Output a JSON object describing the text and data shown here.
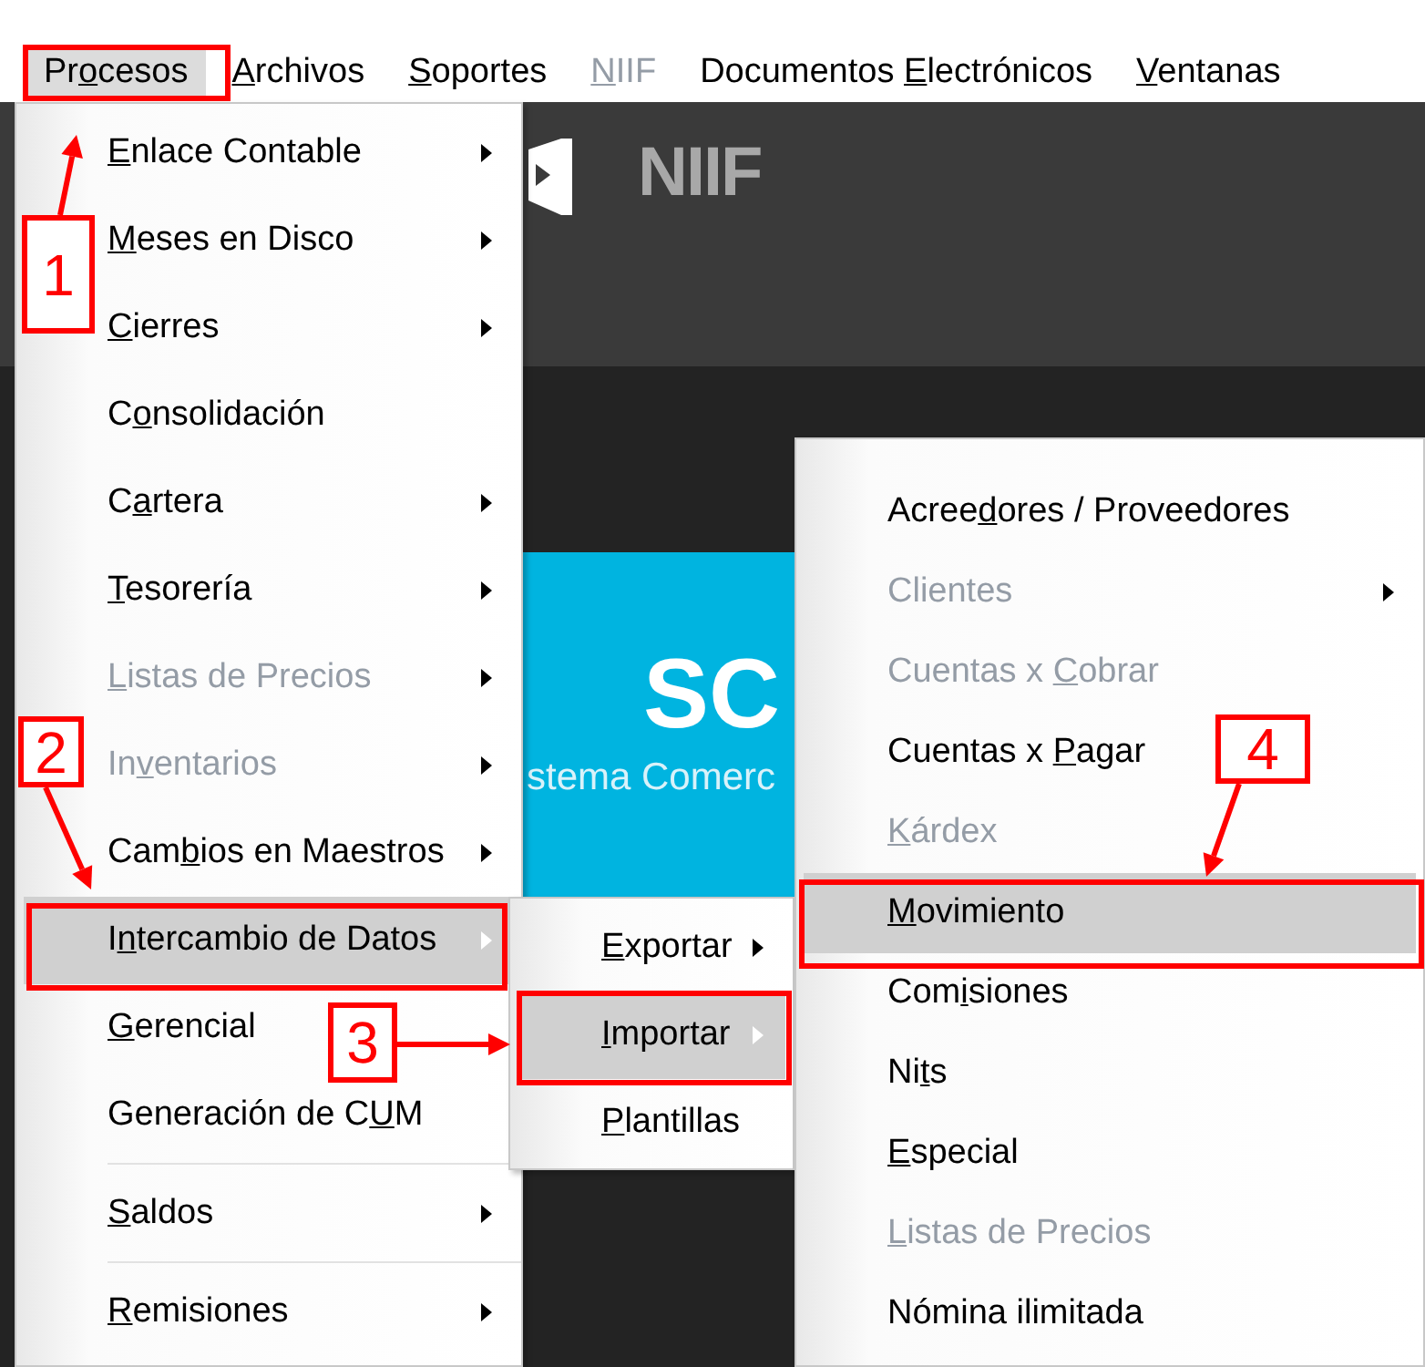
{
  "menu_bar": {
    "items": [
      {
        "before": "Pr",
        "mnemonic": "o",
        "after": "cesos",
        "selected": true,
        "disabled": false
      },
      {
        "mnemonic": "A",
        "after": "rchivos",
        "selected": false,
        "disabled": false
      },
      {
        "mnemonic": "S",
        "after": "oportes",
        "selected": false,
        "disabled": false
      },
      {
        "mnemonic": "N",
        "after": "IIF",
        "selected": false,
        "disabled": true
      },
      {
        "before": "Documentos ",
        "mnemonic": "E",
        "after": "lectrónicos",
        "selected": false,
        "disabled": false
      },
      {
        "mnemonic": "V",
        "after": "entanas",
        "selected": false,
        "disabled": false
      }
    ]
  },
  "desktop": {
    "logo_text": "NIIF",
    "banner_title": "SC",
    "banner_subtitle": "stema Comerc"
  },
  "menus": [
    {
      "items": [
        {
          "kind": "item",
          "mnemonic": "E",
          "after": "nlace Contable",
          "submenu": true,
          "disabled": false,
          "selected": false
        },
        {
          "kind": "item",
          "mnemonic": "M",
          "after": "eses en Disco",
          "submenu": true,
          "disabled": false,
          "selected": false
        },
        {
          "kind": "item",
          "mnemonic": "C",
          "after": "ierres",
          "submenu": true,
          "disabled": false,
          "selected": false
        },
        {
          "kind": "item",
          "before": "C",
          "mnemonic": "o",
          "after": "nsolidación",
          "submenu": false,
          "disabled": false,
          "selected": false
        },
        {
          "kind": "item",
          "before": "C",
          "mnemonic": "a",
          "after": "rtera",
          "submenu": true,
          "disabled": false,
          "selected": false
        },
        {
          "kind": "item",
          "mnemonic": "T",
          "after": "esorería",
          "submenu": true,
          "disabled": false,
          "selected": false
        },
        {
          "kind": "item",
          "mnemonic": "L",
          "after": "istas de Precios",
          "submenu": true,
          "disabled": true,
          "selected": false
        },
        {
          "kind": "item",
          "before": "In",
          "mnemonic": "v",
          "after": "entarios",
          "submenu": true,
          "disabled": true,
          "selected": false
        },
        {
          "kind": "item",
          "before": "Cam",
          "mnemonic": "b",
          "after": "ios en Maestros",
          "submenu": true,
          "disabled": false,
          "selected": false
        },
        {
          "kind": "item",
          "before": "I",
          "mnemonic": "n",
          "after": "tercambio de Datos",
          "submenu": true,
          "disabled": false,
          "selected": true
        },
        {
          "kind": "item",
          "mnemonic": "G",
          "after": "erencial",
          "submenu": false,
          "disabled": false,
          "selected": false
        },
        {
          "kind": "item",
          "before": "Generación de C",
          "mnemonic": "U",
          "after": "M",
          "submenu": false,
          "disabled": false,
          "selected": false
        },
        {
          "kind": "separator"
        },
        {
          "kind": "item",
          "mnemonic": "S",
          "after": "aldos",
          "submenu": true,
          "disabled": false,
          "selected": false
        },
        {
          "kind": "separator"
        },
        {
          "kind": "item",
          "mnemonic": "R",
          "after": "emisiones",
          "submenu": true,
          "disabled": false,
          "selected": false
        }
      ]
    },
    {
      "items": [
        {
          "kind": "item",
          "mnemonic": "E",
          "after": "xportar",
          "submenu": true,
          "disabled": false,
          "selected": false
        },
        {
          "kind": "item",
          "mnemonic": "I",
          "after": "mportar",
          "submenu": true,
          "disabled": false,
          "selected": true
        },
        {
          "kind": "item",
          "mnemonic": "P",
          "after": "lantillas",
          "submenu": false,
          "disabled": false,
          "selected": false
        }
      ]
    },
    {
      "items": [
        {
          "kind": "item",
          "before": "Acree",
          "mnemonic": "d",
          "after": "ores / Proveedores",
          "submenu": false,
          "disabled": false,
          "selected": false
        },
        {
          "kind": "item",
          "before": "Clientes",
          "submenu": true,
          "disabled": true,
          "selected": false
        },
        {
          "kind": "item",
          "before": "Cuentas x ",
          "mnemonic": "C",
          "after": "obrar",
          "submenu": false,
          "disabled": true,
          "selected": false
        },
        {
          "kind": "item",
          "before": "Cuentas x ",
          "mnemonic": "P",
          "after": "agar",
          "submenu": false,
          "disabled": false,
          "selected": false
        },
        {
          "kind": "item",
          "mnemonic": "K",
          "after": "árdex",
          "submenu": false,
          "disabled": true,
          "selected": false
        },
        {
          "kind": "item",
          "mnemonic": "M",
          "after": "ovimiento",
          "submenu": false,
          "disabled": false,
          "selected": true
        },
        {
          "kind": "item",
          "before": "Com",
          "mnemonic": "i",
          "after": "siones",
          "submenu": false,
          "disabled": false,
          "selected": false
        },
        {
          "kind": "item",
          "before": "Ni",
          "mnemonic": "t",
          "after": "s",
          "submenu": false,
          "disabled": false,
          "selected": false
        },
        {
          "kind": "item",
          "mnemonic": "E",
          "after": "special",
          "submenu": false,
          "disabled": false,
          "selected": false
        },
        {
          "kind": "item",
          "mnemonic": "L",
          "after": "istas de Precios",
          "submenu": false,
          "disabled": true,
          "selected": false
        },
        {
          "kind": "item",
          "before": "Nómina ilimitada",
          "submenu": false,
          "disabled": false,
          "selected": false
        }
      ]
    }
  ],
  "annotations": [
    {
      "label": "1"
    },
    {
      "label": "2"
    },
    {
      "label": "3"
    },
    {
      "label": "4"
    }
  ]
}
